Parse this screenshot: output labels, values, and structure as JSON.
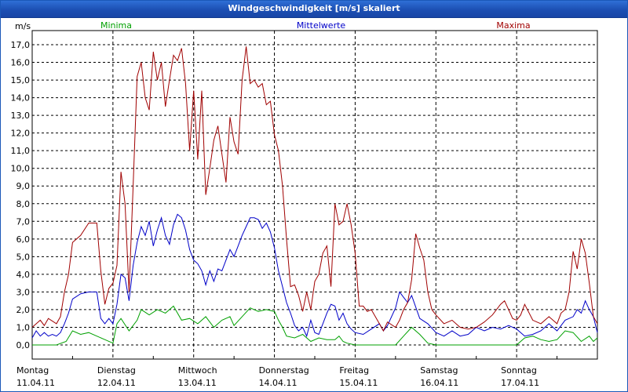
{
  "window": {
    "title": "Windgeschwindigkeit [m/s] skaliert"
  },
  "colors": {
    "minima": "#00a000",
    "mittel": "#0000c8",
    "maxima": "#a00000",
    "title_bar": "#1c4fb3"
  },
  "chart_data": {
    "type": "line",
    "title": "Windgeschwindigkeit [m/s] skaliert",
    "ylabel": "m/s",
    "xlabel": "",
    "ylim": [
      -0.8,
      17.8
    ],
    "yticks": [
      "0,0",
      "1,0",
      "2,0",
      "3,0",
      "4,0",
      "5,0",
      "6,0",
      "7,0",
      "8,0",
      "9,0",
      "10,0",
      "11,0",
      "12,0",
      "13,0",
      "14,0",
      "15,0",
      "16,0",
      "17,0"
    ],
    "grid": true,
    "legend_position": "top",
    "x_axis": {
      "type": "days",
      "range_days": [
        0,
        7
      ],
      "day_labels": [
        {
          "day": "Montag",
          "date": "11.04.11"
        },
        {
          "day": "Dienstag",
          "date": "12.04.11"
        },
        {
          "day": "Mittwoch",
          "date": "13.04.11"
        },
        {
          "day": "Donnerstag",
          "date": "14.04.11"
        },
        {
          "day": "Freitag",
          "date": "15.04.11"
        },
        {
          "day": "Samstag",
          "date": "16.04.11"
        },
        {
          "day": "Sonntag",
          "date": "17.04.11"
        }
      ]
    },
    "series": [
      {
        "name": "Minima",
        "color": "#00a000",
        "points": [
          [
            0,
            0
          ],
          [
            0.3,
            0
          ],
          [
            0.42,
            0.2
          ],
          [
            0.5,
            0.8
          ],
          [
            0.6,
            0.6
          ],
          [
            0.7,
            0.7
          ],
          [
            0.8,
            0.5
          ],
          [
            0.9,
            0.3
          ],
          [
            1.0,
            0.1
          ],
          [
            1.05,
            1.2
          ],
          [
            1.1,
            1.5
          ],
          [
            1.2,
            0.8
          ],
          [
            1.3,
            1.4
          ],
          [
            1.35,
            2.0
          ],
          [
            1.45,
            1.7
          ],
          [
            1.55,
            2.0
          ],
          [
            1.65,
            1.8
          ],
          [
            1.75,
            2.2
          ],
          [
            1.85,
            1.4
          ],
          [
            1.95,
            1.5
          ],
          [
            2.05,
            1.2
          ],
          [
            2.15,
            1.6
          ],
          [
            2.25,
            1.0
          ],
          [
            2.35,
            1.4
          ],
          [
            2.45,
            1.6
          ],
          [
            2.5,
            1.1
          ],
          [
            2.6,
            1.6
          ],
          [
            2.7,
            2.1
          ],
          [
            2.8,
            1.9
          ],
          [
            2.9,
            2.0
          ],
          [
            3.0,
            1.9
          ],
          [
            3.05,
            1.4
          ],
          [
            3.1,
            1.0
          ],
          [
            3.15,
            0.5
          ],
          [
            3.25,
            0.4
          ],
          [
            3.35,
            0.6
          ],
          [
            3.45,
            0.2
          ],
          [
            3.55,
            0.4
          ],
          [
            3.65,
            0.3
          ],
          [
            3.75,
            0.3
          ],
          [
            3.8,
            0.5
          ],
          [
            3.85,
            0.2
          ],
          [
            3.9,
            0.1
          ],
          [
            4.0,
            0
          ],
          [
            4.5,
            0
          ],
          [
            4.6,
            0.5
          ],
          [
            4.7,
            1.0
          ],
          [
            4.8,
            0.6
          ],
          [
            4.9,
            0.1
          ],
          [
            5.0,
            0
          ],
          [
            6.0,
            0
          ],
          [
            6.1,
            0.4
          ],
          [
            6.2,
            0.5
          ],
          [
            6.3,
            0.3
          ],
          [
            6.4,
            0.2
          ],
          [
            6.5,
            0.3
          ],
          [
            6.6,
            0.8
          ],
          [
            6.7,
            0.7
          ],
          [
            6.8,
            0.2
          ],
          [
            6.9,
            0.5
          ],
          [
            6.95,
            0.2
          ],
          [
            7.0,
            0.4
          ]
        ]
      },
      {
        "name": "Mittelwerte",
        "color": "#0000c8",
        "points": [
          [
            0,
            0.4
          ],
          [
            0.05,
            0.8
          ],
          [
            0.1,
            0.5
          ],
          [
            0.15,
            0.7
          ],
          [
            0.2,
            0.5
          ],
          [
            0.25,
            0.6
          ],
          [
            0.3,
            0.5
          ],
          [
            0.35,
            0.7
          ],
          [
            0.4,
            1.2
          ],
          [
            0.45,
            1.8
          ],
          [
            0.5,
            2.6
          ],
          [
            0.6,
            2.9
          ],
          [
            0.7,
            3.0
          ],
          [
            0.8,
            3.0
          ],
          [
            0.85,
            1.5
          ],
          [
            0.9,
            1.2
          ],
          [
            0.95,
            1.5
          ],
          [
            1.0,
            1.2
          ],
          [
            1.05,
            2.3
          ],
          [
            1.1,
            4.0
          ],
          [
            1.15,
            3.8
          ],
          [
            1.2,
            2.5
          ],
          [
            1.25,
            4.5
          ],
          [
            1.3,
            5.8
          ],
          [
            1.35,
            6.7
          ],
          [
            1.4,
            6.2
          ],
          [
            1.45,
            7.0
          ],
          [
            1.5,
            5.6
          ],
          [
            1.55,
            6.5
          ],
          [
            1.6,
            7.2
          ],
          [
            1.65,
            6.2
          ],
          [
            1.7,
            5.7
          ],
          [
            1.75,
            6.8
          ],
          [
            1.8,
            7.4
          ],
          [
            1.85,
            7.2
          ],
          [
            1.9,
            6.5
          ],
          [
            1.95,
            5.4
          ],
          [
            2.0,
            4.8
          ],
          [
            2.05,
            4.6
          ],
          [
            2.1,
            4.2
          ],
          [
            2.15,
            3.4
          ],
          [
            2.2,
            4.2
          ],
          [
            2.25,
            3.6
          ],
          [
            2.3,
            4.3
          ],
          [
            2.35,
            4.2
          ],
          [
            2.4,
            4.8
          ],
          [
            2.45,
            5.4
          ],
          [
            2.5,
            5.0
          ],
          [
            2.55,
            5.6
          ],
          [
            2.6,
            6.2
          ],
          [
            2.65,
            6.7
          ],
          [
            2.7,
            7.2
          ],
          [
            2.75,
            7.2
          ],
          [
            2.8,
            7.1
          ],
          [
            2.85,
            6.6
          ],
          [
            2.9,
            6.9
          ],
          [
            2.95,
            6.4
          ],
          [
            3.0,
            5.5
          ],
          [
            3.05,
            4.2
          ],
          [
            3.1,
            3.3
          ],
          [
            3.15,
            2.4
          ],
          [
            3.2,
            1.8
          ],
          [
            3.25,
            1.1
          ],
          [
            3.3,
            0.8
          ],
          [
            3.35,
            1.0
          ],
          [
            3.4,
            0.5
          ],
          [
            3.45,
            1.4
          ],
          [
            3.5,
            0.7
          ],
          [
            3.55,
            0.6
          ],
          [
            3.6,
            1.2
          ],
          [
            3.65,
            1.8
          ],
          [
            3.7,
            2.3
          ],
          [
            3.75,
            2.2
          ],
          [
            3.8,
            1.4
          ],
          [
            3.85,
            1.8
          ],
          [
            3.9,
            1.2
          ],
          [
            3.95,
            0.9
          ],
          [
            4.0,
            0.7
          ],
          [
            4.1,
            0.6
          ],
          [
            4.2,
            0.9
          ],
          [
            4.3,
            1.2
          ],
          [
            4.35,
            0.8
          ],
          [
            4.4,
            1.1
          ],
          [
            4.5,
            2.1
          ],
          [
            4.55,
            3.0
          ],
          [
            4.6,
            2.7
          ],
          [
            4.65,
            2.4
          ],
          [
            4.7,
            2.8
          ],
          [
            4.8,
            1.5
          ],
          [
            4.9,
            1.2
          ],
          [
            5.0,
            0.7
          ],
          [
            5.1,
            0.5
          ],
          [
            5.2,
            0.8
          ],
          [
            5.3,
            0.5
          ],
          [
            5.4,
            0.6
          ],
          [
            5.5,
            1.0
          ],
          [
            5.6,
            0.8
          ],
          [
            5.7,
            1.0
          ],
          [
            5.8,
            0.9
          ],
          [
            5.9,
            1.1
          ],
          [
            6.0,
            0.9
          ],
          [
            6.1,
            0.5
          ],
          [
            6.2,
            0.6
          ],
          [
            6.3,
            0.8
          ],
          [
            6.4,
            1.2
          ],
          [
            6.5,
            0.8
          ],
          [
            6.6,
            1.4
          ],
          [
            6.7,
            1.6
          ],
          [
            6.75,
            2.0
          ],
          [
            6.8,
            1.8
          ],
          [
            6.85,
            2.5
          ],
          [
            6.9,
            2.0
          ],
          [
            6.95,
            1.6
          ],
          [
            7.0,
            0.7
          ]
        ]
      },
      {
        "name": "Maxima",
        "color": "#a00000",
        "points": [
          [
            0,
            1.0
          ],
          [
            0.1,
            1.4
          ],
          [
            0.15,
            1.1
          ],
          [
            0.2,
            1.5
          ],
          [
            0.3,
            1.2
          ],
          [
            0.35,
            1.6
          ],
          [
            0.4,
            3.0
          ],
          [
            0.45,
            4.0
          ],
          [
            0.5,
            5.8
          ],
          [
            0.6,
            6.2
          ],
          [
            0.7,
            6.9
          ],
          [
            0.8,
            6.9
          ],
          [
            0.85,
            4.2
          ],
          [
            0.9,
            2.3
          ],
          [
            0.95,
            3.2
          ],
          [
            1.0,
            3.5
          ],
          [
            1.05,
            4.5
          ],
          [
            1.1,
            9.8
          ],
          [
            1.15,
            8.0
          ],
          [
            1.2,
            3.0
          ],
          [
            1.25,
            9.0
          ],
          [
            1.3,
            15.2
          ],
          [
            1.35,
            16.0
          ],
          [
            1.4,
            14.0
          ],
          [
            1.45,
            13.3
          ],
          [
            1.5,
            16.6
          ],
          [
            1.55,
            15.0
          ],
          [
            1.6,
            16.0
          ],
          [
            1.65,
            13.5
          ],
          [
            1.7,
            15.0
          ],
          [
            1.75,
            16.4
          ],
          [
            1.8,
            16.1
          ],
          [
            1.85,
            16.8
          ],
          [
            1.9,
            14.8
          ],
          [
            1.95,
            11.0
          ],
          [
            2.0,
            14.4
          ],
          [
            2.05,
            10.5
          ],
          [
            2.1,
            14.4
          ],
          [
            2.15,
            8.5
          ],
          [
            2.2,
            10.0
          ],
          [
            2.25,
            11.6
          ],
          [
            2.3,
            12.4
          ],
          [
            2.35,
            10.8
          ],
          [
            2.4,
            9.2
          ],
          [
            2.45,
            12.9
          ],
          [
            2.5,
            11.5
          ],
          [
            2.55,
            10.8
          ],
          [
            2.6,
            15.0
          ],
          [
            2.65,
            16.9
          ],
          [
            2.7,
            14.8
          ],
          [
            2.75,
            15.0
          ],
          [
            2.8,
            14.6
          ],
          [
            2.85,
            14.8
          ],
          [
            2.9,
            13.6
          ],
          [
            2.95,
            13.8
          ],
          [
            3.0,
            11.9
          ],
          [
            3.05,
            11.0
          ],
          [
            3.1,
            9.0
          ],
          [
            3.15,
            6.0
          ],
          [
            3.2,
            3.3
          ],
          [
            3.25,
            3.4
          ],
          [
            3.3,
            2.8
          ],
          [
            3.35,
            1.9
          ],
          [
            3.4,
            3.0
          ],
          [
            3.45,
            2.0
          ],
          [
            3.5,
            3.6
          ],
          [
            3.55,
            4.0
          ],
          [
            3.6,
            5.2
          ],
          [
            3.65,
            5.6
          ],
          [
            3.7,
            3.3
          ],
          [
            3.75,
            8.0
          ],
          [
            3.8,
            6.8
          ],
          [
            3.85,
            7.0
          ],
          [
            3.9,
            8.0
          ],
          [
            3.95,
            6.8
          ],
          [
            4.0,
            5.2
          ],
          [
            4.05,
            2.2
          ],
          [
            4.1,
            2.2
          ],
          [
            4.15,
            1.9
          ],
          [
            4.2,
            2.0
          ],
          [
            4.3,
            1.2
          ],
          [
            4.35,
            0.8
          ],
          [
            4.4,
            1.3
          ],
          [
            4.5,
            1.0
          ],
          [
            4.55,
            1.4
          ],
          [
            4.6,
            2.0
          ],
          [
            4.65,
            2.4
          ],
          [
            4.7,
            3.7
          ],
          [
            4.75,
            6.3
          ],
          [
            4.8,
            5.5
          ],
          [
            4.85,
            4.8
          ],
          [
            4.9,
            3.0
          ],
          [
            4.95,
            2.0
          ],
          [
            5.0,
            1.7
          ],
          [
            5.1,
            1.2
          ],
          [
            5.2,
            1.4
          ],
          [
            5.3,
            1.0
          ],
          [
            5.4,
            0.9
          ],
          [
            5.5,
            1.0
          ],
          [
            5.6,
            1.3
          ],
          [
            5.7,
            1.7
          ],
          [
            5.8,
            2.3
          ],
          [
            5.85,
            2.5
          ],
          [
            5.9,
            2.0
          ],
          [
            5.95,
            1.5
          ],
          [
            6.0,
            1.4
          ],
          [
            6.05,
            1.7
          ],
          [
            6.1,
            2.3
          ],
          [
            6.2,
            1.4
          ],
          [
            6.3,
            1.2
          ],
          [
            6.4,
            1.6
          ],
          [
            6.5,
            1.2
          ],
          [
            6.55,
            1.8
          ],
          [
            6.6,
            2.0
          ],
          [
            6.65,
            3.0
          ],
          [
            6.7,
            5.3
          ],
          [
            6.75,
            4.3
          ],
          [
            6.8,
            6.0
          ],
          [
            6.85,
            5.2
          ],
          [
            6.9,
            3.5
          ],
          [
            6.95,
            1.6
          ],
          [
            7.0,
            1.2
          ]
        ]
      }
    ]
  }
}
